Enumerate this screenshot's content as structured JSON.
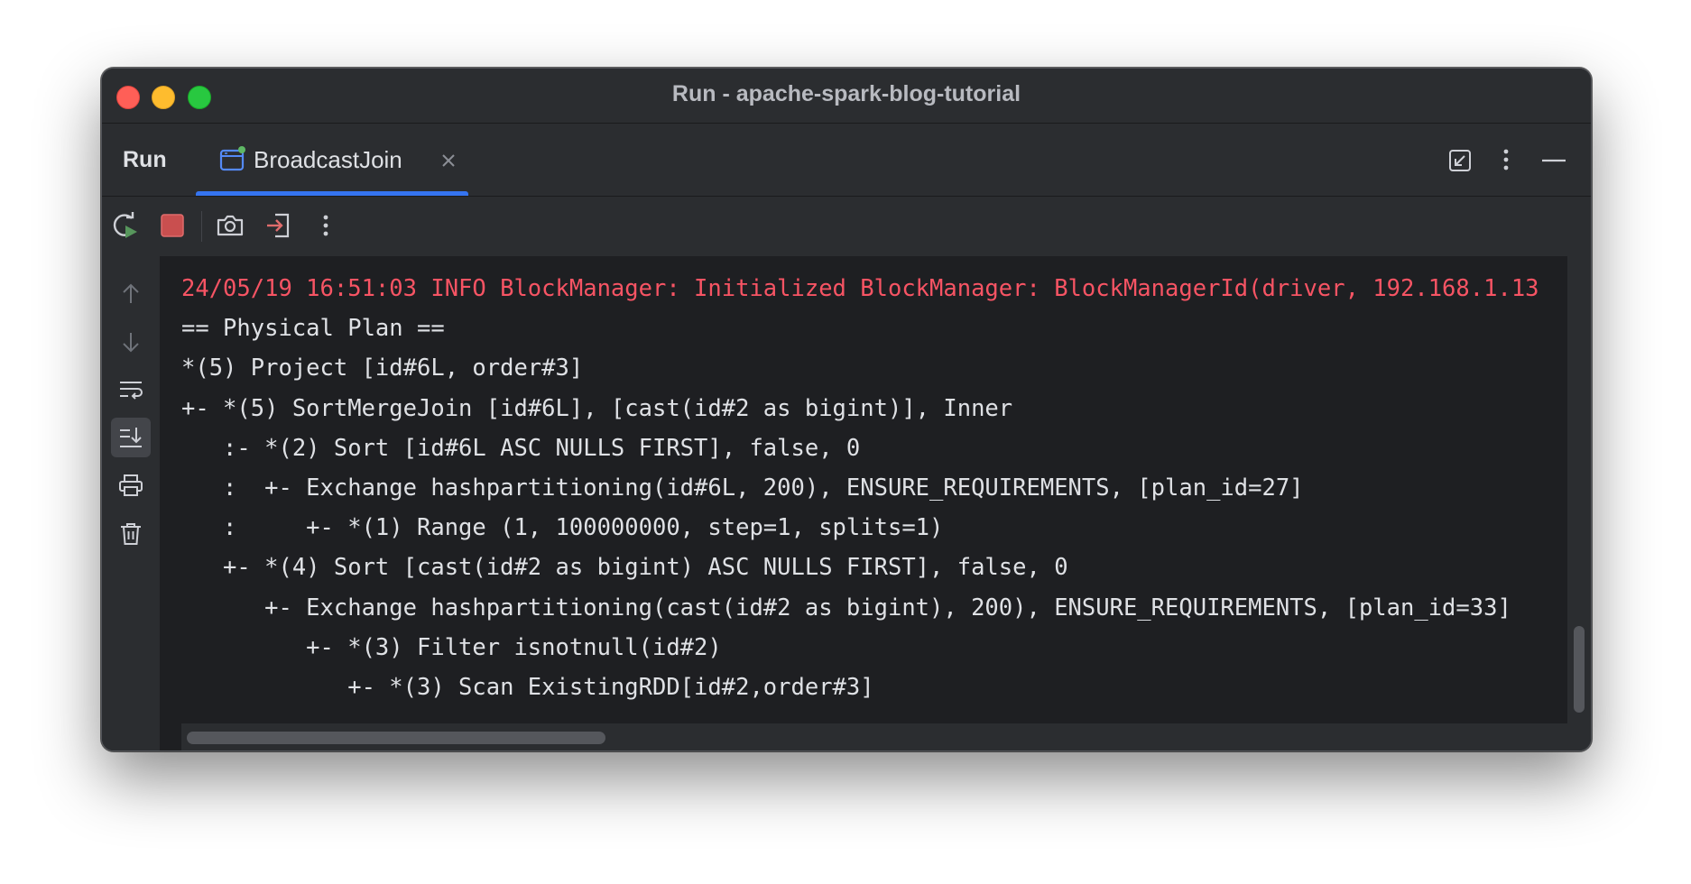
{
  "window": {
    "title": "Run - apache-spark-blog-tutorial"
  },
  "tool_window": {
    "label": "Run",
    "tabs": [
      {
        "label": "BroadcastJoin",
        "active": true,
        "icon": "application-run-icon",
        "closable": true
      }
    ],
    "actions": [
      "restore-layout-icon",
      "more-vertical-icon",
      "minimize-icon"
    ]
  },
  "toolbar": {
    "buttons": [
      "rerun-icon",
      "stop-icon",
      "screenshot-camera-icon",
      "exit-login-icon",
      "more-vertical-icon"
    ]
  },
  "sidebar": {
    "buttons": [
      "arrow-up-icon",
      "arrow-down-icon",
      "soft-wrap-icon",
      "scroll-to-end-icon",
      "print-icon",
      "trash-icon"
    ],
    "active": "scroll-to-end-icon"
  },
  "console": {
    "lines": [
      {
        "text": "24/05/19 16:51:03 INFO BlockManager: Initialized BlockManager: BlockManagerId(driver, 192.168.1.13",
        "type": "stderr"
      },
      {
        "text": "== Physical Plan ==",
        "type": "stdout"
      },
      {
        "text": "*(5) Project [id#6L, order#3]",
        "type": "stdout"
      },
      {
        "text": "+- *(5) SortMergeJoin [id#6L], [cast(id#2 as bigint)], Inner",
        "type": "stdout"
      },
      {
        "text": "   :- *(2) Sort [id#6L ASC NULLS FIRST], false, 0",
        "type": "stdout"
      },
      {
        "text": "   :  +- Exchange hashpartitioning(id#6L, 200), ENSURE_REQUIREMENTS, [plan_id=27]",
        "type": "stdout"
      },
      {
        "text": "   :     +- *(1) Range (1, 100000000, step=1, splits=1)",
        "type": "stdout"
      },
      {
        "text": "   +- *(4) Sort [cast(id#2 as bigint) ASC NULLS FIRST], false, 0",
        "type": "stdout"
      },
      {
        "text": "      +- Exchange hashpartitioning(cast(id#2 as bigint), 200), ENSURE_REQUIREMENTS, [plan_id=33]",
        "type": "stdout"
      },
      {
        "text": "         +- *(3) Filter isnotnull(id#2)",
        "type": "stdout"
      },
      {
        "text": "            +- *(3) Scan ExistingRDD[id#2,order#3]",
        "type": "stdout"
      }
    ]
  },
  "colors": {
    "stderr_text": "#f75464",
    "stdout_text": "#dfe1e5",
    "accent": "#3574f0",
    "background": "#1e1f22",
    "panel": "#2b2d30"
  }
}
